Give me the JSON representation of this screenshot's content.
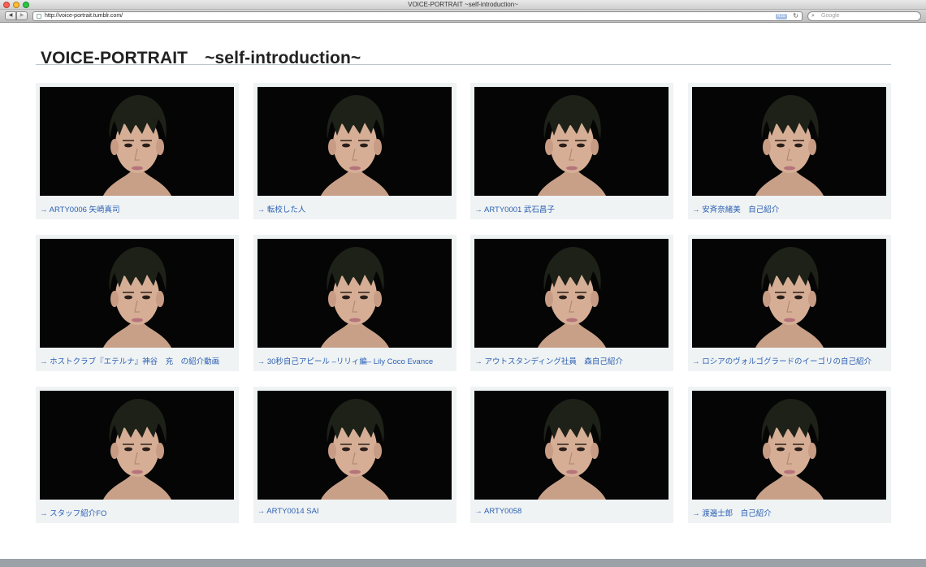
{
  "window": {
    "title": "VOICE-PORTRAIT ~self-introduction~",
    "url": "http://voice-portrait.tumblr.com/",
    "rss_label": "RSS",
    "search_placeholder": "Google"
  },
  "icons": [
    "back-icon",
    "forward-icon",
    "favicon-icon",
    "reload-icon",
    "search-icon",
    "portrait-thumbnail"
  ],
  "page": {
    "title": "VOICE-PORTRAIT　~self-introduction~"
  },
  "videos": [
    {
      "caption": "→ ARTY0006 矢崎真司"
    },
    {
      "caption": "→ 転校した人"
    },
    {
      "caption": "→ ARTY0001 武石昌子"
    },
    {
      "caption": "→ 安斉奈緒美　自己紹介"
    },
    {
      "caption": "→ ホストクラブ『エテルナ』神谷　充　の紹介動画"
    },
    {
      "caption": "→ 30秒自己アピール –リリィ編– Lily Coco Evance"
    },
    {
      "caption": "→ アウトスタンディング社員　森自己紹介"
    },
    {
      "caption": "→ ロシアのヴォルゴグラードのイーゴリの自己紹介"
    },
    {
      "caption": "→ スタッフ紹介FO"
    },
    {
      "caption": "→ ARTY0014 SAI"
    },
    {
      "caption": "→ ARTY0058"
    },
    {
      "caption": "→ 渡邉士郎　自己紹介"
    }
  ]
}
